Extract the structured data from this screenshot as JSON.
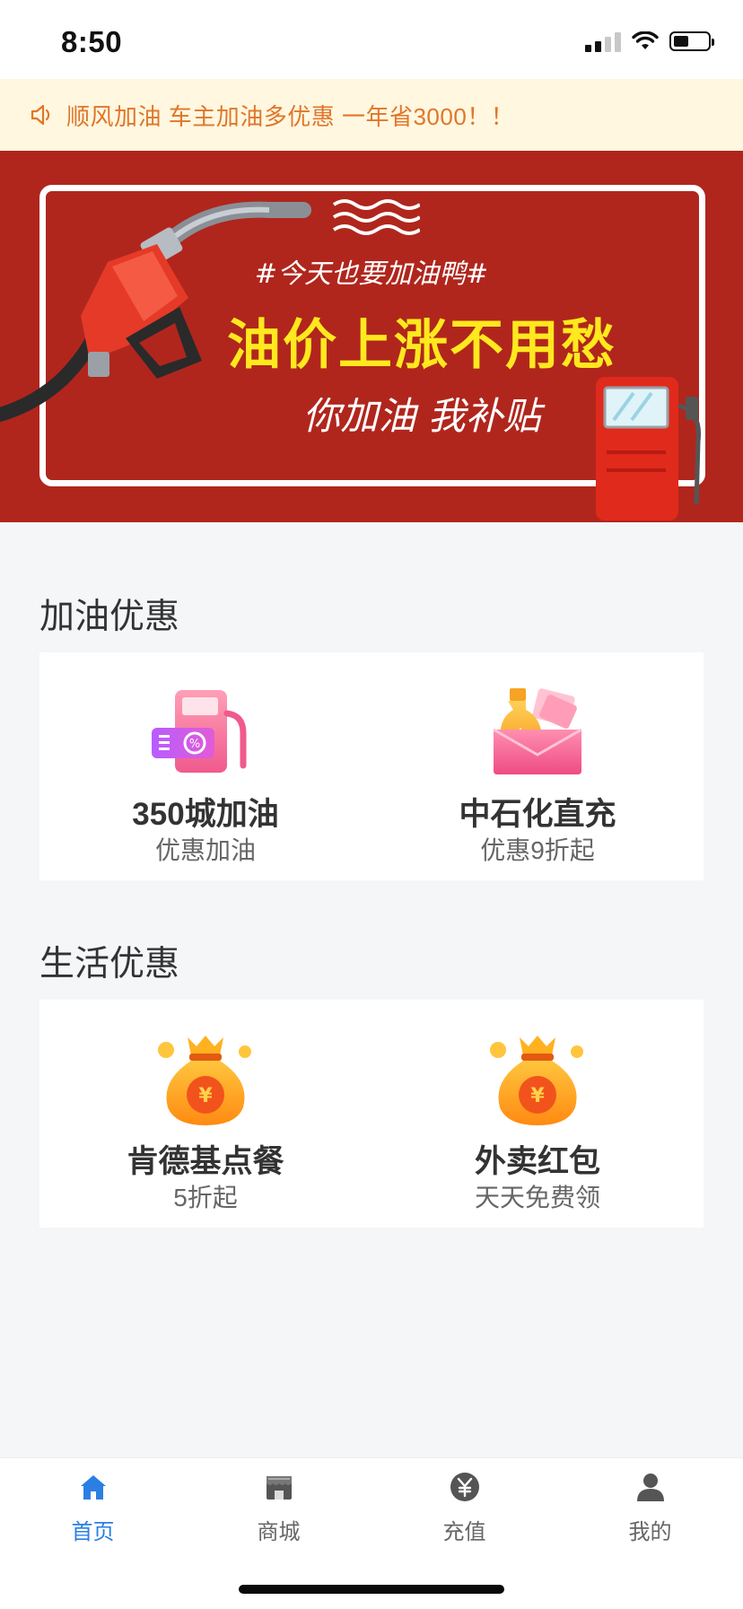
{
  "status_bar": {
    "time": "8:50",
    "battery_level": 0.45
  },
  "notice": {
    "icon": "speaker-icon",
    "text": "顺风加油 车主加油多优惠 一年省3000！！",
    "color": "#e0762a"
  },
  "banner": {
    "hashtag": "#今天也要加油鸭#",
    "headline": "油价上涨不用愁",
    "subtitle": "你加油 我补贴",
    "background": "#b0261d",
    "headline_color": "#ffe81e"
  },
  "sections": [
    {
      "title": "加油优惠",
      "items": [
        {
          "icon": "fuel-pump-discount-icon",
          "title": "350城加油",
          "subtitle": "优惠加油"
        },
        {
          "icon": "oil-red-packet-icon",
          "title": "中石化直充",
          "subtitle": "优惠9折起"
        }
      ]
    },
    {
      "title": "生活优惠",
      "items": [
        {
          "icon": "money-bag-icon",
          "title": "肯德基点餐",
          "subtitle": "5折起"
        },
        {
          "icon": "money-bag-icon",
          "title": "外卖红包",
          "subtitle": "天天免费领"
        }
      ]
    }
  ],
  "tabbar": {
    "active_color": "#2b7fe3",
    "items": [
      {
        "label": "首页",
        "icon": "home-icon",
        "active": true
      },
      {
        "label": "商城",
        "icon": "shop-icon",
        "active": false
      },
      {
        "label": "充值",
        "icon": "recharge-icon",
        "active": false
      },
      {
        "label": "我的",
        "icon": "user-icon",
        "active": false
      }
    ]
  }
}
